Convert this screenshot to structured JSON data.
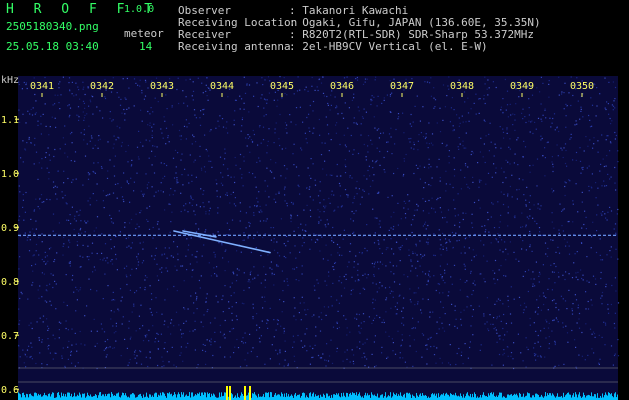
{
  "app": {
    "name": "H R O F F T",
    "version": "1.0.0",
    "filename": "2505180340.png",
    "datetime": "25.05.18 03:40",
    "meteor_label": "meteor",
    "meteor_count": "14"
  },
  "station": {
    "rows": [
      {
        "label": "Observer",
        "value": ": Takanori Kawachi"
      },
      {
        "label": "Receiving Location",
        "value": ": Ogaki, Gifu, JAPAN (136.60E, 35.35N)"
      },
      {
        "label": "Receiver",
        "value": ": R820T2(RTL-SDR) SDR-Sharp 53.372MHz"
      },
      {
        "label": "Receiving antenna",
        "value": ": 2el-HB9CV Vertical (el. E-W)"
      }
    ]
  },
  "chart_data": {
    "type": "heatmap",
    "ylabel": "kHz",
    "x_ticks": [
      "0341",
      "0342",
      "0343",
      "0344",
      "0345",
      "0346",
      "0347",
      "0348",
      "0349",
      "0350"
    ],
    "y_ticks": [
      "1.1",
      "1.0",
      "0.9",
      "0.8",
      "0.7",
      "0.6"
    ],
    "y_tick_values": [
      1.1,
      1.0,
      0.9,
      0.8,
      0.7,
      0.6
    ],
    "ylim": [
      0.58,
      1.18
    ],
    "xlim": [
      0.6,
      10.6
    ],
    "carrier_khz": 0.885,
    "meteor_trails": [
      {
        "x": [
          3.2,
          4.8
        ],
        "y": [
          0.893,
          0.853
        ]
      },
      {
        "x": [
          3.35,
          3.9
        ],
        "y": [
          0.893,
          0.882
        ]
      }
    ],
    "colors": {
      "background": "#0a0a3a",
      "noise": "#2a3aa8",
      "signal": "#7fb0ff",
      "ticks": "#ffff66",
      "baseline": "#00bfff",
      "spike": "#ffff00"
    }
  }
}
